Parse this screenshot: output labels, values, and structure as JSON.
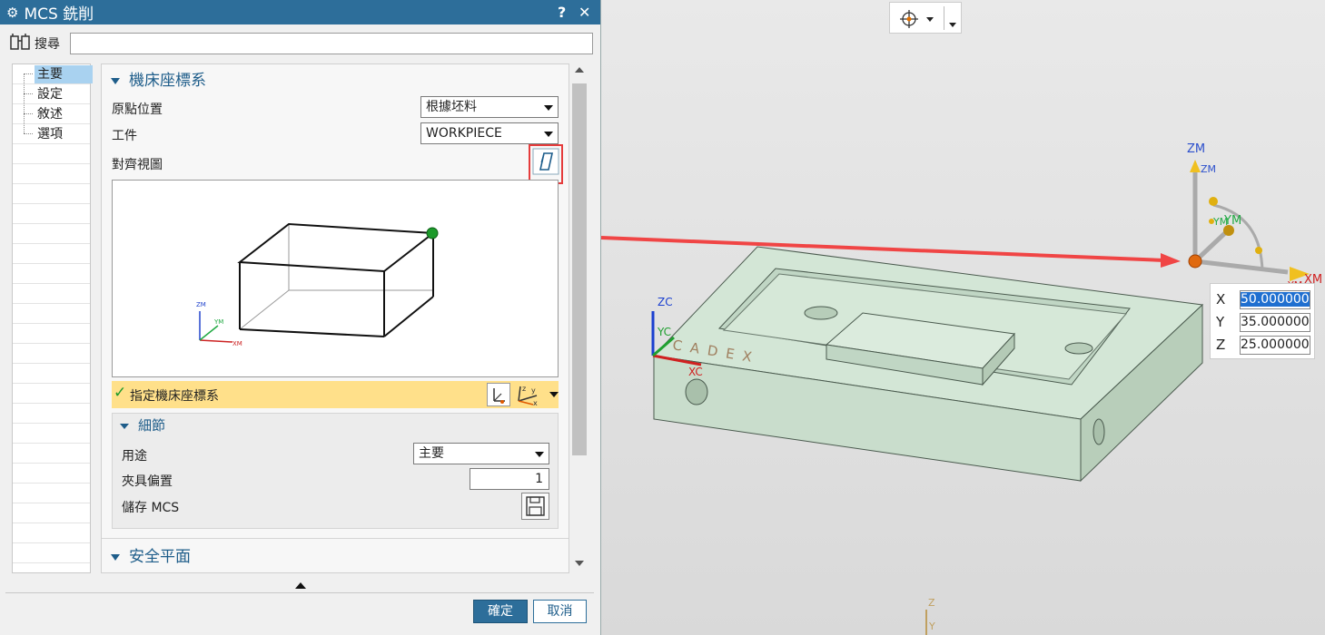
{
  "dialog": {
    "title": "MCS 銑削",
    "help_label": "?",
    "close_label": "✕",
    "search": {
      "label": "搜尋",
      "value": ""
    },
    "nav": {
      "items": [
        {
          "label": "主要"
        },
        {
          "label": "設定"
        },
        {
          "label": "敘述"
        },
        {
          "label": "選項"
        }
      ],
      "selected": 0
    },
    "machine_csys": {
      "heading": "機床座標系",
      "origin_position": {
        "label": "原點位置",
        "value": "根據坯料"
      },
      "workpiece": {
        "label": "工件",
        "value": "WORKPIECE"
      },
      "align_view": {
        "label": "對齊視圖"
      },
      "specify": {
        "label": "指定機床座標系"
      }
    },
    "details": {
      "heading": "細節",
      "purpose": {
        "label": "用途",
        "value": "主要"
      },
      "fixture_offset": {
        "label": "夾具偏置",
        "value": "1"
      },
      "save_mcs": {
        "label": "儲存 MCS"
      }
    },
    "clearance_plane": {
      "heading": "安全平面"
    },
    "ok_label": "確定",
    "cancel_label": "取消"
  },
  "preview_axes": {
    "zm": "ZM",
    "ym": "YM",
    "xm": "XM"
  },
  "viewport": {
    "workcs_axes": {
      "zc": "ZC",
      "yc": "YC",
      "xc": "XC"
    },
    "engraving": "CADEX",
    "manip_axes": {
      "zm1": "ZM",
      "zm2": "ZM",
      "ym1": "YM",
      "ym2": "YM",
      "xm1": "XM",
      "xm2": "YM"
    },
    "coords": [
      {
        "axis": "X",
        "value": "50.000000"
      },
      {
        "axis": "Y",
        "value": "35.000000"
      },
      {
        "axis": "Z",
        "value": "25.000000"
      }
    ],
    "abs_axes": {
      "z": "Z",
      "y": "Y"
    }
  },
  "colors": {
    "accent": "#2d6e9a",
    "highlight": "#ffe08a",
    "arrow": "#f04545",
    "part": "#cfe3d2"
  },
  "icons": [
    "gear-icon",
    "help-icon",
    "close-icon",
    "binoculars-icon",
    "align-view-icon",
    "csys-dialog-icon",
    "csys-icon",
    "save-icon",
    "checkmark-icon",
    "crosshair-icon"
  ]
}
